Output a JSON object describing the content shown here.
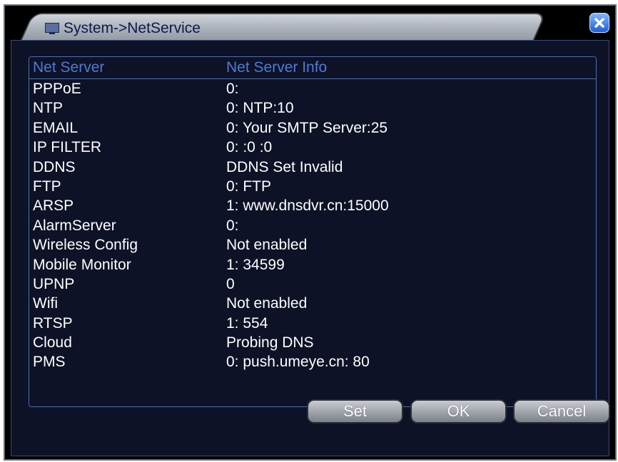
{
  "window": {
    "title": "System->NetService",
    "title_icon": "monitor-icon",
    "close_icon": "close-icon",
    "colors": {
      "background": "#000000",
      "header_text": "#4f7ad6",
      "row_text": "#ffffff",
      "close_button": "#2f6fe0"
    }
  },
  "table": {
    "columns": [
      "Net Server",
      "Net Server Info"
    ],
    "rows": [
      {
        "name": "PPPoE",
        "info": "0:"
      },
      {
        "name": "NTP",
        "info": "0: NTP:10"
      },
      {
        "name": "EMAIL",
        "info": "0: Your SMTP Server:25"
      },
      {
        "name": "IP FILTER",
        "info": "0: :0 :0"
      },
      {
        "name": "DDNS",
        "info": "DDNS Set Invalid"
      },
      {
        "name": "FTP",
        "info": "0: FTP"
      },
      {
        "name": "ARSP",
        "info": "1: www.dnsdvr.cn:15000"
      },
      {
        "name": "AlarmServer",
        "info": "0:"
      },
      {
        "name": "Wireless Config",
        "info": "Not enabled"
      },
      {
        "name": "Mobile Monitor",
        "info": "1: 34599"
      },
      {
        "name": "UPNP",
        "info": "0"
      },
      {
        "name": "Wifi",
        "info": "Not enabled"
      },
      {
        "name": "RTSP",
        "info": "1: 554"
      },
      {
        "name": "Cloud",
        "info": "Probing DNS"
      },
      {
        "name": "PMS",
        "info": "0: push.umeye.cn: 80"
      }
    ]
  },
  "buttons": {
    "set": "Set",
    "ok": "OK",
    "cancel": "Cancel"
  }
}
